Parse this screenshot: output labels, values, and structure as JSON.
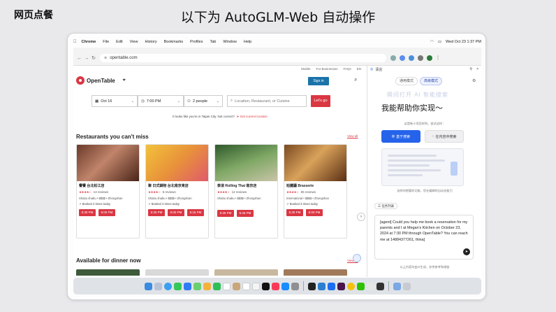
{
  "corner_label": "网页点餐",
  "heading": "以下为 AutoGLM-Web 自动操作",
  "menubar": {
    "app": "Chrome",
    "items": [
      "File",
      "Edit",
      "View",
      "History",
      "Bookmarks",
      "Profiles",
      "Tab",
      "Window",
      "Help"
    ],
    "clock": "Wed Oct 23  1:37 PM"
  },
  "browser": {
    "url": "opentable.com"
  },
  "opentable": {
    "top_links": [
      "Mobile",
      "For Businesses",
      "FAQs",
      "EN"
    ],
    "logo": "OpenTable",
    "sign_in": "Sign in",
    "search": {
      "date": "Oct 16",
      "time": "7:00 PM",
      "people": "2 people",
      "placeholder": "Location, Restaurant, or Cuisine",
      "button": "Let's go"
    },
    "location_msg": "It looks like you're in Taipei City. Not correct?",
    "location_link": "Get current location",
    "section1": "Restaurants you can't miss",
    "view_all": "View all",
    "cards": [
      {
        "name": "饗饗 台北松江店",
        "reviews": "13 reviews",
        "meta": "Shabu shabu • $$$$ • Zhongshan",
        "booked": "Booked 4 times today",
        "slots": [
          "5:30 PM",
          "6:00 PM"
        ]
      },
      {
        "name": "聚 日式鍋物 台北南京東店",
        "reviews": "6 reviews",
        "meta": "Shabu shabu • $$$$ • Zhongshan",
        "booked": "Booked 4 times today",
        "slots": [
          "5:30 PM",
          "6:00 PM",
          "6:15 PM"
        ]
      },
      {
        "name": "泰滾 Rolling Thai 南京店",
        "reviews": "12 reviews",
        "meta": "Shabu shabu • $$$$ • Zhongshan",
        "booked": "",
        "slots": [
          "5:30 PM",
          "5:45 PM"
        ]
      },
      {
        "name": "柏麗廳 Brasserie",
        "reviews": "85 reviews",
        "meta": "International • $$$$ • Zhongshan",
        "booked": "Booked 3 times today",
        "slots": [
          "5:30 PM",
          "6:00 PM"
        ]
      }
    ],
    "section2": "Available for dinner now",
    "view_all2": "View all"
  },
  "assistant": {
    "title": "清言",
    "modes": [
      "通用模式",
      "高级模式"
    ],
    "ghost_text": "瞬间打开 AI 智能搜索",
    "help": "我能帮助你实现～",
    "try_hint": "这是新小项目样例，尝试这样：",
    "options": [
      "基于搜索",
      "在内容中搜索"
    ],
    "caption": "选择你想要的功能，您在编辑时自动化能力",
    "task_chip": "任务列表",
    "input_text": "[agent] Could you help me book a reservation for my parents and I at Megan's Kitchen on October 23, 2024 at 7:30 PM through OpenTable? You can reach me at 14884377261, thina]",
    "footer": "以上内容均由AI生成，仅供参考和借鉴"
  },
  "colors": {
    "brand_red": "#da3743",
    "accent_blue": "#2563eb"
  }
}
